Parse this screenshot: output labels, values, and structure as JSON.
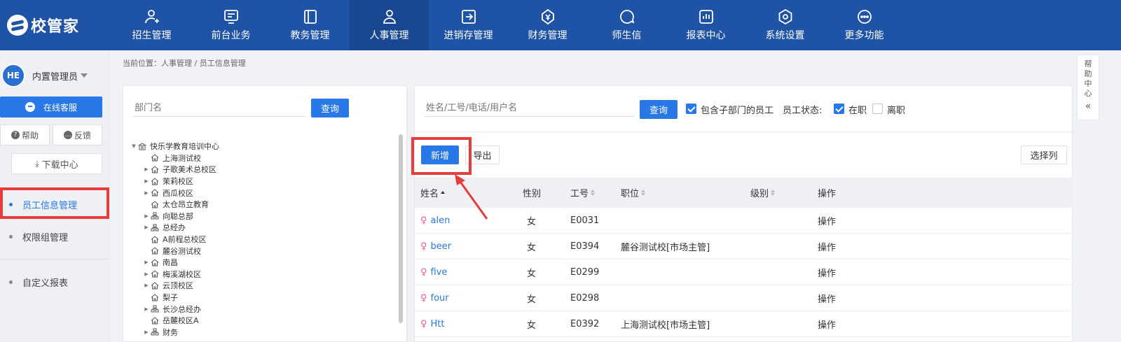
{
  "app": {
    "logo_text": "校管家"
  },
  "nav": [
    {
      "label": "招生管理",
      "icon": "user-plus-icon"
    },
    {
      "label": "前台业务",
      "icon": "monitor-icon"
    },
    {
      "label": "教务管理",
      "icon": "book-icon"
    },
    {
      "label": "人事管理",
      "icon": "person-icon",
      "active": true
    },
    {
      "label": "进销存管理",
      "icon": "inventory-icon"
    },
    {
      "label": "财务管理",
      "icon": "yen-shield-icon"
    },
    {
      "label": "师生信",
      "icon": "chat-icon"
    },
    {
      "label": "报表中心",
      "icon": "bar-report-icon"
    },
    {
      "label": "系统设置",
      "icon": "settings-hex-icon"
    },
    {
      "label": "更多功能",
      "icon": "more-dots-icon"
    }
  ],
  "sidebar": {
    "avatar_text": "HE",
    "user_name": "内置管理员",
    "kefu_label": "在线客服",
    "help_label": "帮助",
    "feedback_label": "反馈",
    "download_label": "下载中心",
    "menu": [
      {
        "label": "员工信息管理",
        "active": true
      },
      {
        "label": "权限组管理"
      },
      {
        "label": "自定义报表"
      }
    ]
  },
  "breadcrumb": "当前位置：人事管理 / 员工信息管理",
  "tree_panel": {
    "placeholder": "部门名",
    "query_label": "查询",
    "nodes": [
      {
        "label": "快乐学教育培训中心",
        "level": 0,
        "toggle": "open",
        "icon": "bank-icon"
      },
      {
        "label": "上海测试校",
        "level": 1,
        "toggle": "none",
        "icon": "home-icon"
      },
      {
        "label": "子歌美术总校区",
        "level": 1,
        "toggle": "closed",
        "icon": "home-icon"
      },
      {
        "label": "茉莉校区",
        "level": 1,
        "toggle": "closed",
        "icon": "home-icon"
      },
      {
        "label": "西瓜校区",
        "level": 1,
        "toggle": "closed",
        "icon": "home-icon"
      },
      {
        "label": "太仓昂立教育",
        "level": 1,
        "toggle": "none",
        "icon": "home-icon"
      },
      {
        "label": "向聪总部",
        "level": 1,
        "toggle": "closed",
        "icon": "org-icon"
      },
      {
        "label": "总经办",
        "level": 1,
        "toggle": "closed",
        "icon": "org-icon"
      },
      {
        "label": "A前程总校区",
        "level": 1,
        "toggle": "none",
        "icon": "home-icon"
      },
      {
        "label": "麓谷测试校",
        "level": 1,
        "toggle": "none",
        "icon": "home-icon"
      },
      {
        "label": "南昌",
        "level": 1,
        "toggle": "closed",
        "icon": "home-icon"
      },
      {
        "label": "梅溪湖校区",
        "level": 1,
        "toggle": "closed",
        "icon": "home-icon"
      },
      {
        "label": "云顶校区",
        "level": 1,
        "toggle": "closed",
        "icon": "home-icon"
      },
      {
        "label": "梨子",
        "level": 1,
        "toggle": "none",
        "icon": "home-icon"
      },
      {
        "label": "长沙总经办",
        "level": 1,
        "toggle": "closed",
        "icon": "org-icon"
      },
      {
        "label": "岳麓校区A",
        "level": 1,
        "toggle": "none",
        "icon": "home-icon"
      },
      {
        "label": "财务",
        "level": 1,
        "toggle": "closed",
        "icon": "org-icon"
      }
    ]
  },
  "filter": {
    "placeholder": "姓名/工号/电话/用户名",
    "query_label": "查询",
    "include_sub_label": "包含子部门的员工",
    "include_sub_checked": true,
    "status_label": "员工状态:",
    "active_label": "在职",
    "active_checked": true,
    "resigned_label": "离职",
    "resigned_checked": false
  },
  "toolbar": {
    "add_label": "新增",
    "export_label": "导出",
    "columns_label": "选择列"
  },
  "table": {
    "headers": {
      "name": "姓名",
      "gender": "性别",
      "id": "工号",
      "position": "职位",
      "level": "级别",
      "action": "操作"
    },
    "rows": [
      {
        "name": "alen",
        "gender": "女",
        "id": "E0031",
        "position": "",
        "level": "",
        "action": "操作"
      },
      {
        "name": "beer",
        "gender": "女",
        "id": "E0394",
        "position": "麓谷测试校[市场主管]",
        "level": "",
        "action": "操作"
      },
      {
        "name": "five",
        "gender": "女",
        "id": "E0299",
        "position": "",
        "level": "",
        "action": "操作"
      },
      {
        "name": "four",
        "gender": "女",
        "id": "E0298",
        "position": "",
        "level": "",
        "action": "操作"
      },
      {
        "name": "Htt",
        "gender": "女",
        "id": "E0392",
        "position": "上海测试校[市场主管]",
        "level": "",
        "action": "操作"
      }
    ]
  },
  "help_tab": {
    "chars": [
      "帮",
      "助",
      "中",
      "心"
    ],
    "chevron": "«"
  },
  "colors": {
    "nav_bg": "#1f53a6",
    "primary": "#2878e8",
    "highlight": "#e63c3c",
    "female": "#f05a8c"
  }
}
